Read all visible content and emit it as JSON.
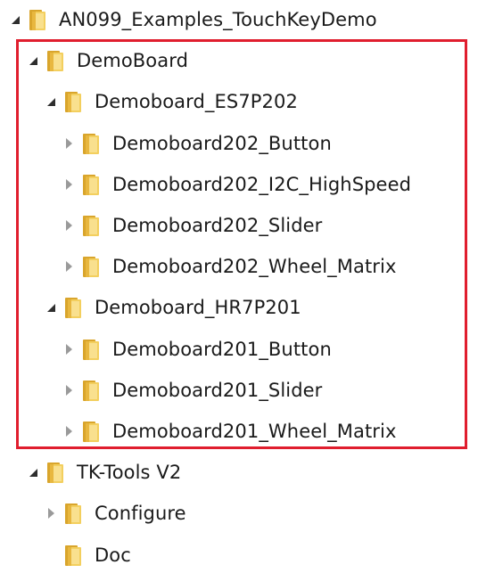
{
  "theme": {
    "selection_border": "#e01e2e",
    "folder_color": "#f1c74a"
  },
  "tree": {
    "nodes": [
      {
        "label": "AN099_Examples_TouchKeyDemo",
        "level": 0,
        "state": "expanded",
        "icon": "folder-icon"
      },
      {
        "label": "DemoBoard",
        "level": 1,
        "state": "expanded",
        "icon": "folder-icon"
      },
      {
        "label": "Demoboard_ES7P202",
        "level": 2,
        "state": "expanded",
        "icon": "folder-icon"
      },
      {
        "label": "Demoboard202_Button",
        "level": 3,
        "state": "collapsed",
        "icon": "folder-icon"
      },
      {
        "label": "Demoboard202_I2C_HighSpeed",
        "level": 3,
        "state": "collapsed",
        "icon": "folder-icon"
      },
      {
        "label": "Demoboard202_Slider",
        "level": 3,
        "state": "collapsed",
        "icon": "folder-icon"
      },
      {
        "label": "Demoboard202_Wheel_Matrix",
        "level": 3,
        "state": "collapsed",
        "icon": "folder-icon"
      },
      {
        "label": "Demoboard_HR7P201",
        "level": 2,
        "state": "expanded",
        "icon": "folder-icon"
      },
      {
        "label": "Demoboard201_Button",
        "level": 3,
        "state": "collapsed",
        "icon": "folder-icon"
      },
      {
        "label": "Demoboard201_Slider",
        "level": 3,
        "state": "collapsed",
        "icon": "folder-icon"
      },
      {
        "label": "Demoboard201_Wheel_Matrix",
        "level": 3,
        "state": "collapsed",
        "icon": "folder-icon"
      },
      {
        "label": "TK-Tools V2",
        "level": 1,
        "state": "expanded",
        "icon": "folder-icon"
      },
      {
        "label": "Configure",
        "level": 2,
        "state": "collapsed",
        "icon": "folder-icon"
      },
      {
        "label": "Doc",
        "level": 2,
        "state": "leaf",
        "icon": "folder-icon"
      }
    ]
  }
}
